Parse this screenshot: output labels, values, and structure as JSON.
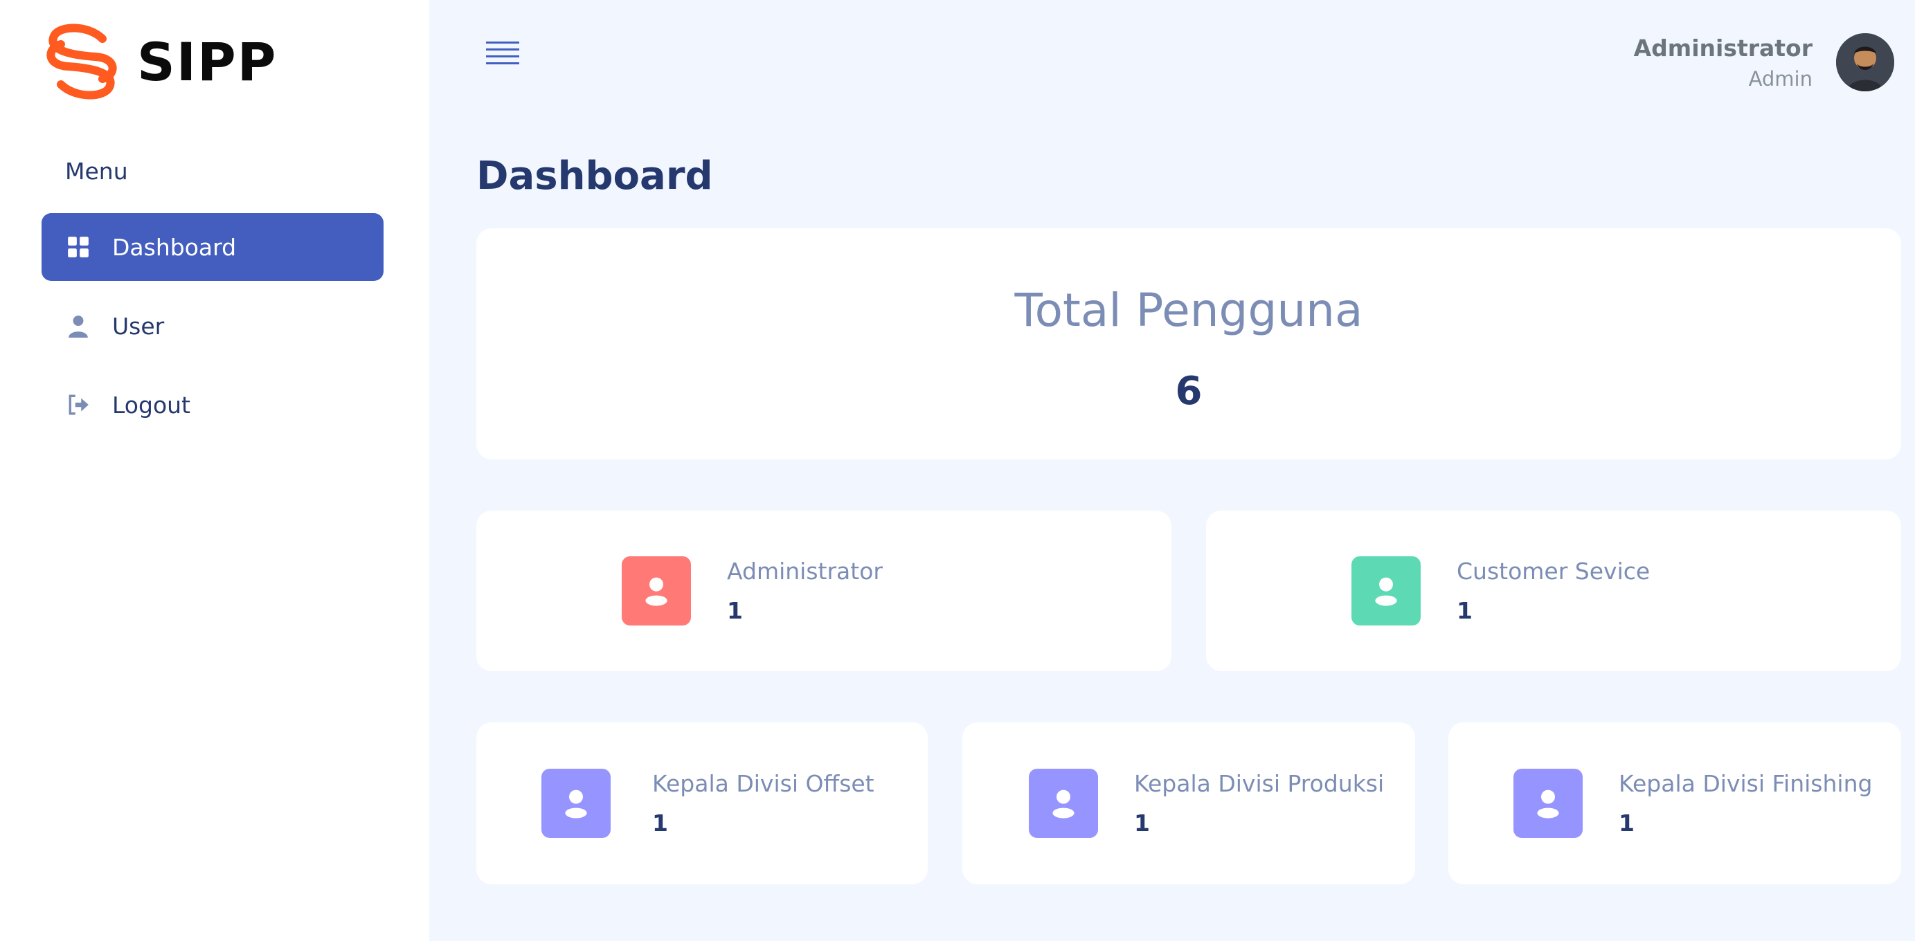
{
  "brand": {
    "name": "SIPP",
    "logo_icon": "sipp-logo-icon",
    "logo_color": "#ff5a1f"
  },
  "sidebar": {
    "menu_title": "Menu",
    "items": [
      {
        "label": "Dashboard",
        "icon": "grid-icon",
        "active": true
      },
      {
        "label": "User",
        "icon": "user-icon",
        "active": false
      },
      {
        "label": "Logout",
        "icon": "logout-icon",
        "active": false
      }
    ]
  },
  "header": {
    "menu_icon": "hamburger-icon",
    "user": {
      "name": "Administrator",
      "role": "Admin",
      "avatar_icon": "avatar"
    }
  },
  "page": {
    "title": "Dashboard"
  },
  "total": {
    "label": "Total Pengguna",
    "value": "6"
  },
  "stats": [
    {
      "label": "Administrator",
      "value": "1",
      "color": "#ff7976"
    },
    {
      "label": "Customer Sevice",
      "value": "1",
      "color": "#57caeb"
    },
    {
      "label": "Kepala Divisi Offset",
      "value": "1",
      "color": "#9694ff"
    },
    {
      "label": "Kepala Divisi Produksi",
      "value": "1",
      "color": "#9694ff"
    },
    {
      "label": "Kepala Divisi Finishing",
      "value": "1",
      "color": "#9694ff"
    }
  ],
  "colors": {
    "primary": "#435ebe",
    "background": "#f2f7ff",
    "heading": "#25396f",
    "green": "#5ddab4"
  }
}
